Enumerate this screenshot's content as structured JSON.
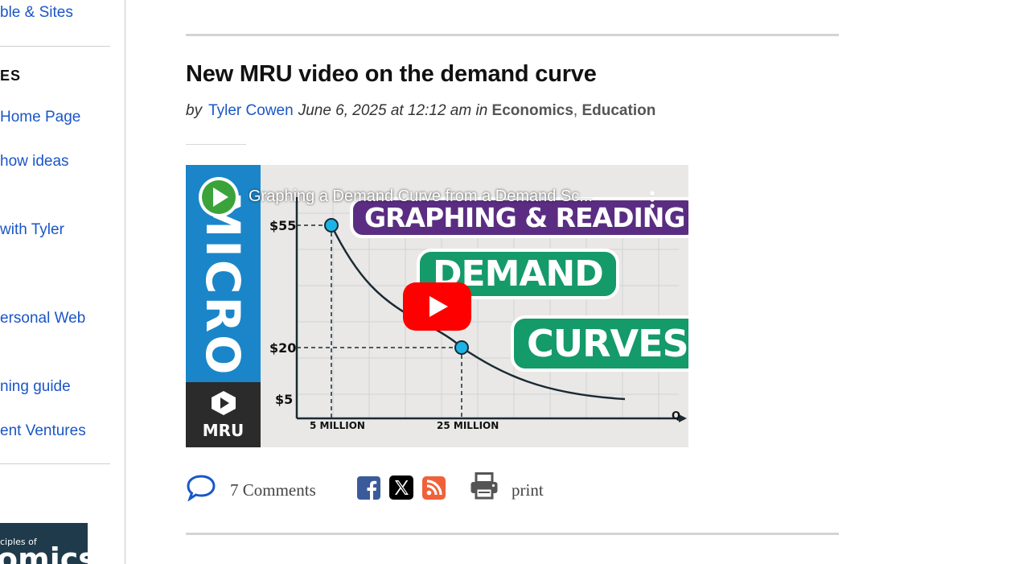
{
  "sidebar": {
    "links": [
      {
        "label": "ble & Sites"
      },
      {
        "label": "Home Page"
      },
      {
        "label": "how ideas"
      },
      {
        "label": "with Tyler"
      },
      {
        "label": "ersonal Web"
      },
      {
        "label": "ning guide"
      },
      {
        "label": "ent Ventures"
      }
    ],
    "section_heading": "ES",
    "book": {
      "small_text": "ciples of",
      "big_text": "omics"
    }
  },
  "post": {
    "title": "New MRU video on the demand curve",
    "by": "by",
    "author": "Tyler Cowen",
    "date": "June 6, 2025 at 12:12 am",
    "in": "in",
    "categories": [
      "Economics",
      "Education"
    ],
    "separator": ","
  },
  "video": {
    "title": "Graphing a Demand Curve from a Demand Sc...",
    "channel_icon": "play-triangle-icon",
    "side_label": "MICRO",
    "brand": "MRU",
    "headline": [
      "GRAPHING & READING",
      "DEMAND",
      "CURVES"
    ],
    "graph": {
      "y_ticks": [
        "$55",
        "$20",
        "$5"
      ],
      "x_ticks": [
        "5 MILLION",
        "25 MILLION"
      ],
      "x_axis_label": "Q"
    },
    "colors": {
      "accent": "#1a86c9",
      "play": "#ff0000",
      "headline_purple": "#5a2d82",
      "headline_green": "#159a6a"
    }
  },
  "share": {
    "comments_label": "7 Comments",
    "print_label": "print",
    "icons": [
      "comment-bubble-icon",
      "facebook-icon",
      "x-icon",
      "rss-icon",
      "printer-icon"
    ]
  }
}
